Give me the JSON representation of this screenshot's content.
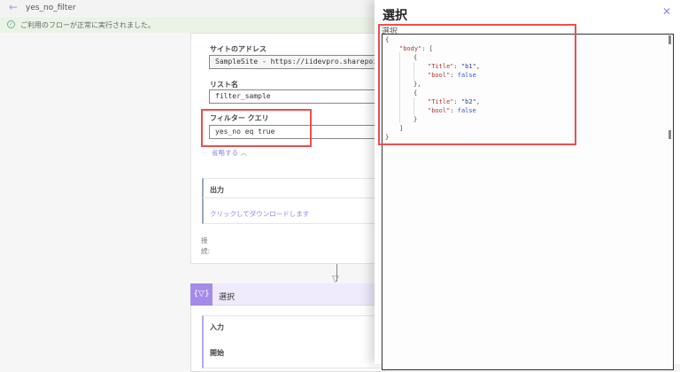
{
  "header": {
    "back_icon": "arrow-left-icon",
    "flow_name": "yes_no_filter"
  },
  "banner": {
    "icon": "check-circle-icon",
    "message": "ご利用のフローが正常に実行されました。"
  },
  "card": {
    "site_label": "サイトのアドレス",
    "site_value": "SampleSite - https://iidevpro.sharepoint.c",
    "list_label": "リスト名",
    "list_value": "filter_sample",
    "filter_label": "フィルター クエリ",
    "filter_value": "yes_no eq true",
    "collapse_link": "省略する ︿",
    "output_label": "出力",
    "download_link": "クリックしてダウンロードします",
    "connection_label": "接続:"
  },
  "card2": {
    "icon": "select-data-icon",
    "icon_text": "{▽}",
    "title": "選択",
    "input_label": "入力",
    "start_label": "開始"
  },
  "panel": {
    "title": "選択",
    "close_icon": "close-icon",
    "field_label": "選択",
    "code_lines": [
      {
        "t": "{"
      },
      {
        "t": "\"body\": [",
        "k": "\"body\"",
        "rest": ": ["
      },
      {
        "t": "{"
      },
      {
        "k": "\"Title\"",
        "sep": ": ",
        "v": "\"b1\"",
        "end": ","
      },
      {
        "k": "\"bool\"",
        "sep": ": ",
        "v": "false",
        "end": ""
      },
      {
        "t": "},"
      },
      {
        "t": "{"
      },
      {
        "k": "\"Title\"",
        "sep": ": ",
        "v": "\"b2\"",
        "end": ","
      },
      {
        "k": "\"bool\"",
        "sep": ": ",
        "v": "false",
        "end": ""
      },
      {
        "t": "}"
      },
      {
        "t": "]"
      },
      {
        "t": "}"
      }
    ]
  },
  "colors": {
    "accent": "#8a8ae8",
    "highlight": "#e85050",
    "success_bg": "#eaf4e6",
    "action_purple": "#a58be8"
  }
}
